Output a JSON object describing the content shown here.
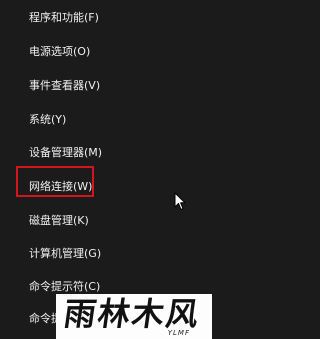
{
  "menu": {
    "items": [
      {
        "label": "程序和功能(F)"
      },
      {
        "label": "电源选项(O)"
      },
      {
        "label": "事件查看器(V)"
      },
      {
        "label": "系统(Y)"
      },
      {
        "label": "设备管理器(M)"
      },
      {
        "label": "网络连接(W)"
      },
      {
        "label": "磁盘管理(K)"
      },
      {
        "label": "计算机管理(G)"
      },
      {
        "label": "命令提示符(C)"
      },
      {
        "label": "命令提示符(管理员)(A)"
      }
    ],
    "highlighted_item": "网络连接(W)"
  },
  "watermark": {
    "logo_text": "雨林木风",
    "sub_text": "YLMF"
  },
  "colors": {
    "menu_background": "#1b1b1b",
    "menu_text": "#f0f0f0",
    "highlight_border": "#d4151f"
  },
  "icons": {
    "cursor": "mouse-pointer-icon"
  }
}
